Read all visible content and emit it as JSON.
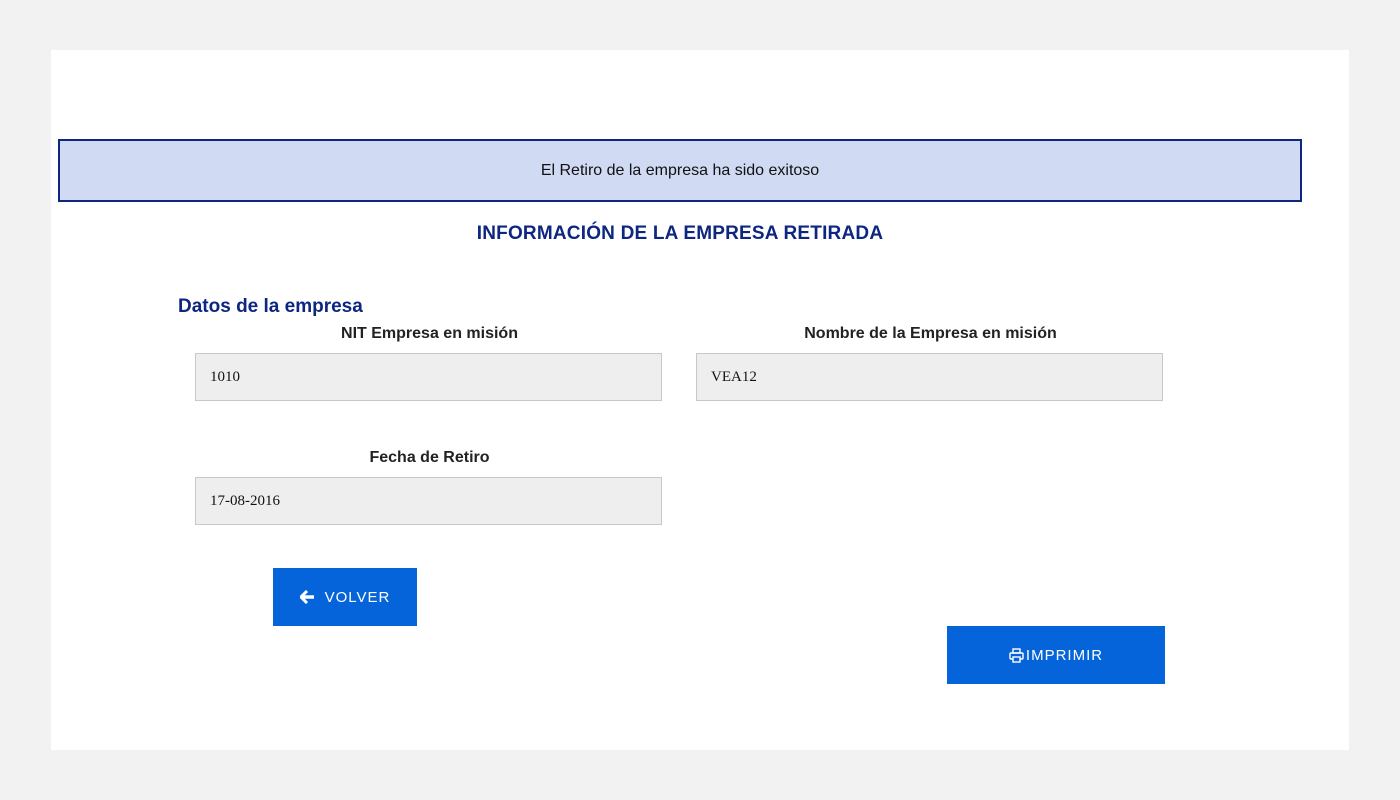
{
  "alert": {
    "message": "El Retiro de la empresa ha sido exitoso"
  },
  "page_title": "INFORMACIÓN DE LA EMPRESA RETIRADA",
  "section": {
    "title": "Datos de la empresa"
  },
  "fields": {
    "nit": {
      "label": "NIT Empresa en misión",
      "value": "1010"
    },
    "nombre": {
      "label": "Nombre de la Empresa en misión",
      "value": "VEA12"
    },
    "fecha": {
      "label": "Fecha de Retiro",
      "value": "17-08-2016"
    }
  },
  "buttons": {
    "volver": {
      "label": "VOLVER",
      "icon": "arrow-left-icon"
    },
    "imprimir": {
      "label": "IMPRIMIR",
      "icon": "printer-icon"
    }
  },
  "colors": {
    "accent": "#0d2680",
    "button": "#0564d9",
    "alert_bg": "#d0daf3"
  }
}
